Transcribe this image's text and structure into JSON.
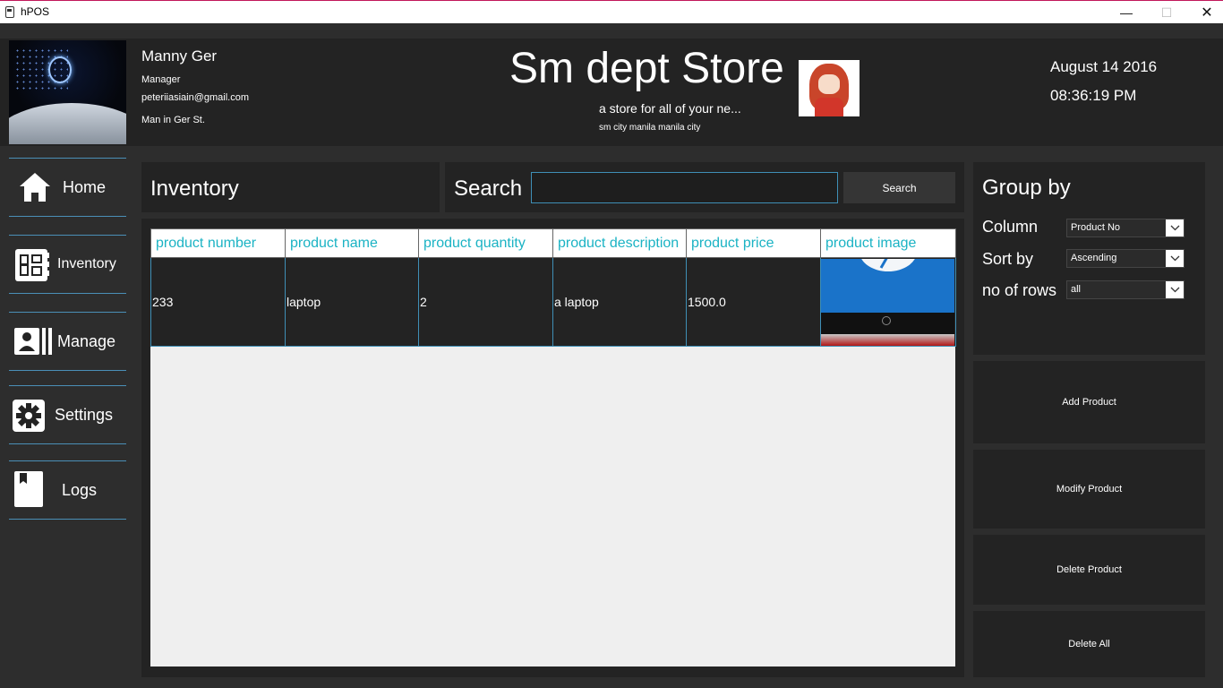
{
  "window": {
    "title": "hPOS",
    "minimize": "—",
    "maximize": "☐",
    "close": "✕"
  },
  "user": {
    "name": "Manny Ger",
    "role": "Manager",
    "email": "peteriiasiain@gmail.com",
    "address": "Man in Ger  St."
  },
  "store": {
    "name": "Sm dept Store",
    "tagline": "a store for all of your ne...",
    "location": "sm city manila manila city"
  },
  "clock": {
    "date": "August 14 2016",
    "time": "08:36:19 PM"
  },
  "sidebar": {
    "items": [
      {
        "label": "Home",
        "icon": "home-icon"
      },
      {
        "label": "Inventory",
        "icon": "inventory-icon"
      },
      {
        "label": "Manage",
        "icon": "manage-icon"
      },
      {
        "label": "Settings",
        "icon": "gear-icon"
      },
      {
        "label": "Logs",
        "icon": "book-icon"
      }
    ]
  },
  "main": {
    "title": "Inventory",
    "search": {
      "label": "Search",
      "value": "",
      "button": "Search"
    },
    "table": {
      "columns": [
        "product number",
        "product name",
        "product quantity",
        "product description",
        "product price",
        "product image"
      ],
      "rows": [
        {
          "number": "233",
          "name": "laptop",
          "quantity": "2",
          "description": "a laptop",
          "price": "1500.0"
        }
      ]
    }
  },
  "group_by": {
    "title": "Group by",
    "column": {
      "label": "Column",
      "value": "Product No"
    },
    "sort": {
      "label": "Sort by",
      "value": "Ascending"
    },
    "rows": {
      "label": "no of rows",
      "value": "all"
    }
  },
  "actions": {
    "add": "Add Product",
    "modify": "Modify Product",
    "delete": "Delete Product",
    "delete_all": "Delete All"
  },
  "colors": {
    "accent": "#1bb3c4",
    "border_blue": "#3f8fb6",
    "panel": "#232323",
    "background": "#2d2d2d"
  }
}
